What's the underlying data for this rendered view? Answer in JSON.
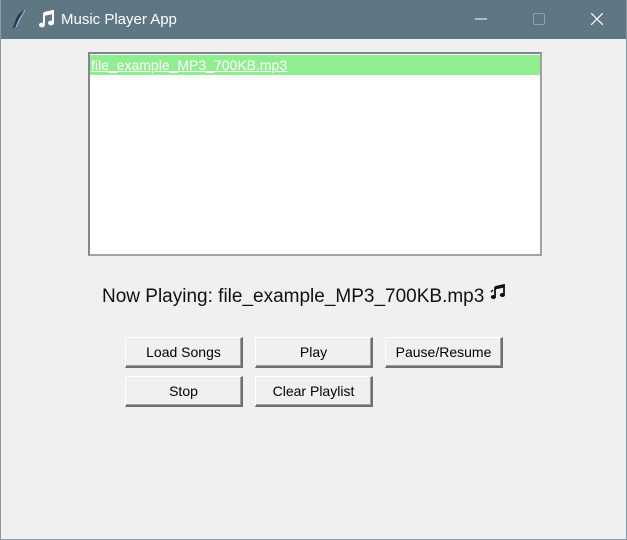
{
  "window": {
    "title": "Music Player App"
  },
  "playlist": {
    "items": [
      {
        "label": "file_example_MP3_700KB.mp3",
        "selected": true
      }
    ]
  },
  "status": {
    "now_playing_text": "Now Playing: file_example_MP3_700KB.mp3"
  },
  "controls": {
    "load_songs": "Load Songs",
    "play": "Play",
    "pause_resume": "Pause/Resume",
    "stop": "Stop",
    "clear_playlist": "Clear Playlist"
  },
  "icons": {
    "app": "tk-feather-icon",
    "title_note": "music-note-icon",
    "now_playing_note": "music-notes-icon"
  },
  "colors": {
    "titlebar": "#5f7683",
    "selection": "#90ee90",
    "background": "#f0f0f0"
  }
}
